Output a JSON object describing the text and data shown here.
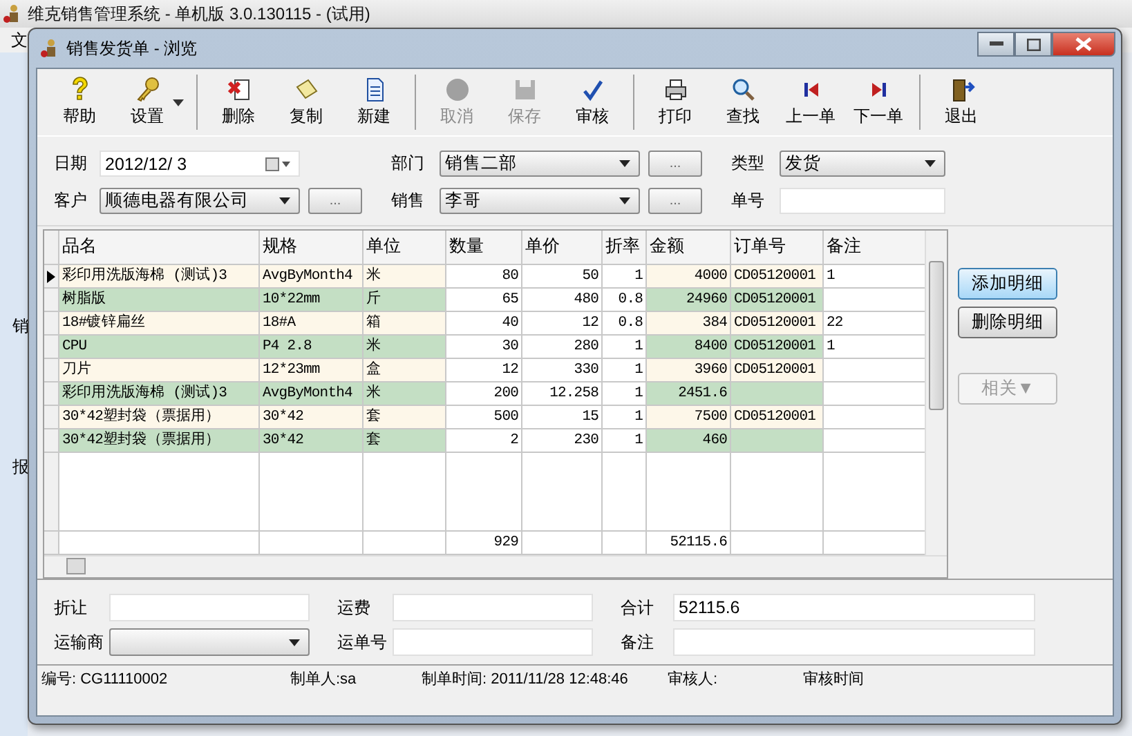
{
  "app": {
    "title": "维克销售管理系统 - 单机版 3.0.130115 - (试用)",
    "menu": [
      "文"
    ],
    "side_labels": [
      "销",
      "报"
    ]
  },
  "window": {
    "title": "销售发货单 - 浏览"
  },
  "toolbar": [
    {
      "kind": "button",
      "label": "帮助",
      "disabled": false
    },
    {
      "kind": "button",
      "label": "设置",
      "disabled": false,
      "dropdown": true
    },
    {
      "kind": "separator"
    },
    {
      "kind": "button",
      "label": "删除",
      "disabled": false
    },
    {
      "kind": "button",
      "label": "复制",
      "disabled": false
    },
    {
      "kind": "button",
      "label": "新建",
      "disabled": false
    },
    {
      "kind": "separator"
    },
    {
      "kind": "button",
      "label": "取消",
      "disabled": true
    },
    {
      "kind": "button",
      "label": "保存",
      "disabled": true
    },
    {
      "kind": "button",
      "label": "审核",
      "disabled": false
    },
    {
      "kind": "separator"
    },
    {
      "kind": "button",
      "label": "打印",
      "disabled": false
    },
    {
      "kind": "button",
      "label": "查找",
      "disabled": false
    },
    {
      "kind": "button",
      "label": "上一单",
      "disabled": false
    },
    {
      "kind": "button",
      "label": "下一单",
      "disabled": false
    },
    {
      "kind": "separator"
    },
    {
      "kind": "button",
      "label": "退出",
      "disabled": false
    }
  ],
  "header_form": [
    [
      {
        "label": "日期",
        "kind": "date",
        "value": "2012/12/ 3"
      },
      {
        "label": "部门",
        "kind": "select",
        "value": "销售二部",
        "more": "..."
      },
      {
        "label": "类型",
        "kind": "select",
        "value": "发货"
      }
    ],
    [
      {
        "label": "客户",
        "kind": "select",
        "value": "顺德电器有限公司",
        "more": "..."
      },
      {
        "label": "销售",
        "kind": "select",
        "value": "李哥",
        "more": "..."
      },
      {
        "label": "单号",
        "kind": "text"
      }
    ]
  ],
  "table": {
    "columns": [
      {
        "title": "品名"
      },
      {
        "title": "规格"
      },
      {
        "title": "单位"
      },
      {
        "title": "数量",
        "total": "929"
      },
      {
        "title": "单价"
      },
      {
        "title": "折率"
      },
      {
        "title": "金额",
        "total": "52115.6"
      },
      {
        "title": "订单号"
      },
      {
        "title": "备注"
      }
    ],
    "rows": [
      {
        "selected": true,
        "color": "#fdf7e9",
        "cells": [
          "彩印用洗版海棉 (测试)3",
          "AvgByMonth4",
          "米",
          "80",
          "50",
          "1",
          "4000",
          "CD05120001",
          "1"
        ]
      },
      {
        "selected": false,
        "color": "#c4dfc4",
        "cells": [
          "树脂版",
          "10*22mm",
          "斤",
          "65",
          "480",
          "0.8",
          "24960",
          "CD05120001",
          null
        ]
      },
      {
        "selected": false,
        "color": "#fdf7e9",
        "cells": [
          "18#镀锌扁丝",
          "18#A",
          "箱",
          "40",
          "12",
          "0.8",
          "384",
          "CD05120001",
          "22"
        ]
      },
      {
        "selected": false,
        "color": "#c4dfc4",
        "cells": [
          "CPU",
          "P4 2.8",
          "米",
          "30",
          "280",
          "1",
          "8400",
          "CD05120001",
          "1"
        ]
      },
      {
        "selected": false,
        "color": "#fdf7e9",
        "cells": [
          "刀片",
          "12*23mm",
          "盒",
          "12",
          "330",
          "1",
          "3960",
          "CD05120001",
          null
        ]
      },
      {
        "selected": false,
        "color": "#c4dfc4",
        "cells": [
          "彩印用洗版海棉 (测试)3",
          "AvgByMonth4",
          "米",
          "200",
          "12.258",
          "1",
          "2451.6",
          null,
          null
        ]
      },
      {
        "selected": false,
        "color": "#fdf7e9",
        "cells": [
          "30*42塑封袋（票据用）",
          "30*42",
          "套",
          "500",
          "15",
          "1",
          "7500",
          "CD05120001",
          null
        ]
      },
      {
        "selected": false,
        "color": "#c4dfc4",
        "cells": [
          "30*42塑封袋（票据用）",
          "30*42",
          "套",
          "2",
          "230",
          "1",
          "460",
          null,
          null
        ]
      }
    ]
  },
  "side_buttons": [
    {
      "label": "添加明细",
      "focused": true,
      "disabled": false
    },
    {
      "label": "删除明细",
      "focused": false,
      "disabled": false
    },
    {
      "label": "相关▼",
      "focused": false,
      "disabled": true
    }
  ],
  "footer_form": [
    [
      {
        "label": "折让",
        "kind": "text"
      },
      {
        "label": "运费",
        "kind": "text"
      },
      {
        "label": "合计",
        "kind": "text",
        "value": "52115.6"
      }
    ],
    [
      {
        "label": "运输商",
        "kind": "select"
      },
      {
        "label": "运单号",
        "kind": "text"
      },
      {
        "label": "备注",
        "kind": "text"
      }
    ]
  ],
  "status_bar": [
    "编号: CG11110002",
    "制单人:sa",
    "制单时间: 2011/11/28 12:48:46",
    "审核人:",
    "审核时间"
  ]
}
